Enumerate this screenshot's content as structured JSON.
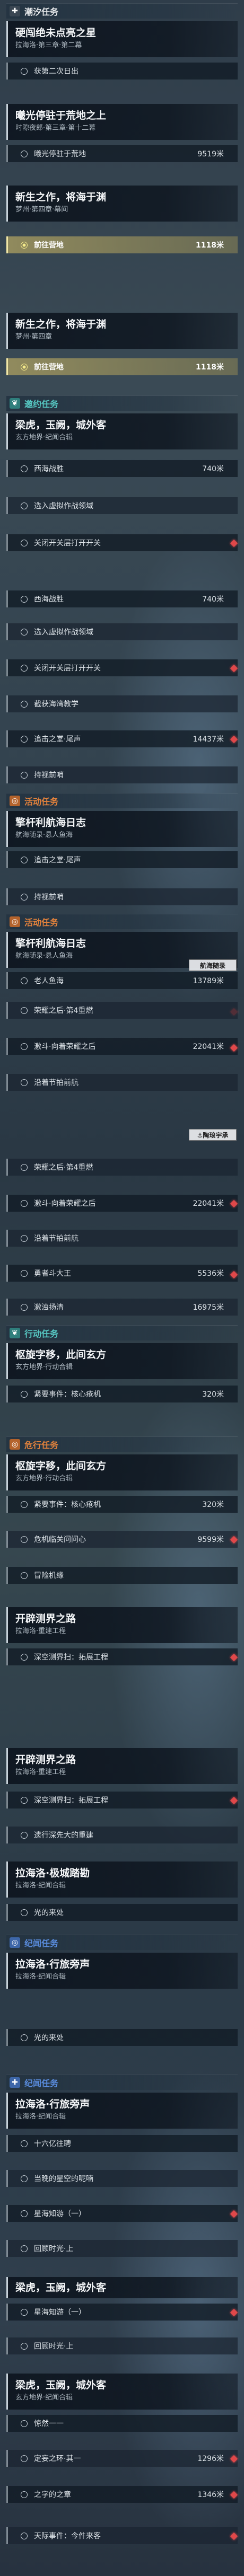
{
  "colors": {
    "cyan": "#57c9c4",
    "orange": "#e3823c",
    "blue": "#5a8de0",
    "active_bar": "#a09664",
    "marker": "#e0484a"
  },
  "sections": {
    "s1": {
      "title": "潮汐任务",
      "icon": "plus-icon",
      "color": "#e6e8ea"
    },
    "s2": {
      "title": "邀约任务",
      "icon": "leaf-icon",
      "color": "#57c9c4"
    },
    "s3": {
      "title": "活动任务",
      "icon": "swirl-icon",
      "color": "#e3823c"
    },
    "s4": {
      "title": "活动任务",
      "icon": "swirl-icon",
      "color": "#e3823c"
    },
    "s5": {
      "title": "行动任务",
      "icon": "leaf-icon",
      "color": "#57c9c4"
    },
    "s6": {
      "title": "危行任务",
      "icon": "swirl-icon",
      "color": "#e3823c"
    },
    "s7": {
      "title": "纪闻任务",
      "icon": "swirl-icon",
      "color": "#5a8de0"
    },
    "s8": {
      "title": "纪闻任务",
      "icon": "plus-icon",
      "color": "#5a8de0"
    }
  },
  "quests": {
    "q1": {
      "title": "硬闯绝未点亮之星",
      "sub": "拉海洛·第三章·第二幕"
    },
    "q2": {
      "title": "曦光停驻于荒地之上",
      "sub": "时隙夜郎·第三章·第十二幕"
    },
    "q3": {
      "title": "新生之作，将海于渊",
      "sub": "梦州·第四章·幕间"
    },
    "q4": {
      "title": "新生之作，将海于渊",
      "sub": "梦州·第四章"
    },
    "q5": {
      "title": "梁虎，玉阙，城外客",
      "sub": "玄方地界·纪闻合辑"
    },
    "q6": {
      "title": "擎杆利航海日志",
      "sub": "航海随录·悬人鱼海"
    },
    "q7": {
      "title": "擎杆利航海日志",
      "sub": "航海随录·悬人鱼海"
    },
    "q8": {
      "title": "枢旋字移，此间玄方",
      "sub": "玄方地界·行动合辑"
    },
    "q9": {
      "title": "枢旋字移，此间玄方",
      "sub": "玄方地界·行动合辑"
    },
    "q10": {
      "title": "开辟测界之路",
      "sub": "拉海洛·重建工程"
    },
    "q11": {
      "title": "开辟测界之路",
      "sub": "拉海洛·重建工程"
    },
    "q12": {
      "title": "拉海洛·极城踏勘",
      "sub": "拉海洛·纪闻合辑"
    },
    "q13": {
      "title": "拉海洛·行旅旁声",
      "sub": "拉海洛·纪闻合辑"
    },
    "q14": {
      "title": "拉海洛·行旅旁声",
      "sub": "拉海洛·纪闻合辑"
    },
    "q15": {
      "title": "梁虎，玉阙，城外客",
      "sub": "玄方地界·纪闻合辑"
    },
    "q16": {
      "title": "梁虎，玉阙，城外客",
      "sub": "玄方地界·纪闻合辑"
    }
  },
  "objectives": {
    "o1": {
      "text": "获第二次日出",
      "dist": ""
    },
    "o2": {
      "text": "曦光停驻于荒地",
      "dist": "9519米"
    },
    "o3": {
      "text": "前往营地",
      "dist": "1118米"
    },
    "o4": {
      "text": "前往营地",
      "dist": "1118米"
    },
    "o5": {
      "text": "西海战胜",
      "dist": "740米"
    },
    "o6": {
      "text": "选入虚拟作战领域",
      "dist": ""
    },
    "o7": {
      "text": "关闭开关层打开开关",
      "dist": ""
    },
    "o8": {
      "text": "西海战胜",
      "dist": "740米"
    },
    "o9": {
      "text": "选入虚拟作战领域",
      "dist": ""
    },
    "o10": {
      "text": "关闭开关层打开开关",
      "dist": ""
    },
    "o11": {
      "text": "截获海湾教学",
      "dist": ""
    },
    "o12": {
      "text": "追击之堂·尾声",
      "dist": "14437米"
    },
    "o13": {
      "text": "持视前哨",
      "dist": ""
    },
    "o14": {
      "text": "追击之堂·尾声",
      "dist": ""
    },
    "o15": {
      "text": "持视前哨",
      "dist": ""
    },
    "o16": {
      "text": "老人鱼海",
      "dist": "13789米"
    },
    "o17": {
      "text": "荣耀之后·第4重燃",
      "dist": ""
    },
    "o18": {
      "text": "激斗·向着荣耀之后",
      "dist": "22041米"
    },
    "o19": {
      "text": "沿着节拍前航",
      "dist": ""
    },
    "o20": {
      "text": "荣耀之后·第4重燃",
      "dist": ""
    },
    "o21": {
      "text": "激斗·向着荣耀之后",
      "dist": "22041米"
    },
    "o22": {
      "text": "沿着节拍前航",
      "dist": ""
    },
    "o23": {
      "text": "勇者斗大王",
      "dist": "5536米"
    },
    "o24": {
      "text": "激浊扬清",
      "dist": "16975米"
    },
    "o25": {
      "text": "紧要事件：核心疮机",
      "dist": "320米"
    },
    "o26": {
      "text": "紧要事件：核心疮机",
      "dist": "320米"
    },
    "o27": {
      "text": "危机临关问问心",
      "dist": "9599米"
    },
    "o28": {
      "text": "冒险机缘",
      "dist": ""
    },
    "o29": {
      "text": "深空测界扫：拓展工程",
      "dist": ""
    },
    "o30": {
      "text": "深空测界扫：拓展工程",
      "dist": ""
    },
    "o31": {
      "text": "遗行深先大的重建",
      "dist": ""
    },
    "o32": {
      "text": "光的来处",
      "dist": ""
    },
    "o33": {
      "text": "光的来处",
      "dist": ""
    },
    "o34": {
      "text": "十六亿往聘",
      "dist": ""
    },
    "o35": {
      "text": "当晚的星空的呢喃",
      "dist": ""
    },
    "o36": {
      "text": "星海知游（一）",
      "dist": ""
    },
    "o37": {
      "text": "回顾时光·上",
      "dist": ""
    },
    "o38": {
      "text": "星海知游（一）",
      "dist": ""
    },
    "o39": {
      "text": "回顾时光·上",
      "dist": ""
    },
    "o40": {
      "text": "惊然一一",
      "dist": ""
    },
    "o41": {
      "text": "定妄之环·其一",
      "dist": "1296米"
    },
    "o42": {
      "text": "之字的之章",
      "dist": "1346米"
    },
    "o43": {
      "text": "天际事件：今件来客",
      "dist": ""
    }
  },
  "tags": {
    "t1": "航海随录",
    "t2": "⚓陶琅宇承"
  }
}
